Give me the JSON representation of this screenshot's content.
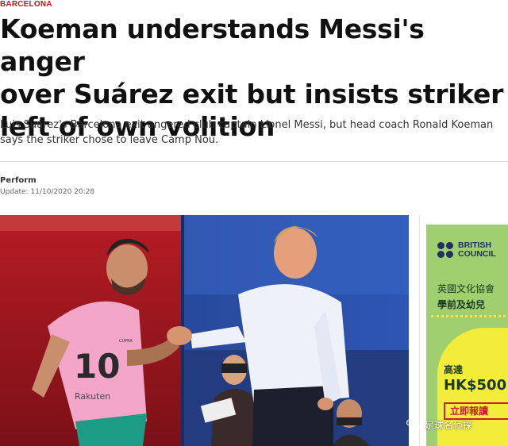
{
  "article": {
    "category": "BARCELONA",
    "headline_lines": [
      "Koeman understands Messi's anger",
      "over Suárez exit but insists striker",
      "left of own volition"
    ],
    "dek_lines": [
      "Luis Suárez's Barcelona exit angered club captain Lionel Messi, but head coach Ronald Koeman",
      "says the striker chose to leave Camp Nou."
    ],
    "author": "Perform",
    "updated": "Update: 11/10/2020 20:28"
  },
  "photo": {
    "shirt_number": "10",
    "shirt_sponsor": "Rakuten",
    "kit_brand": "CUPRA"
  },
  "ad": {
    "brand_lines": [
      "BRITISH",
      "COUNCIL"
    ],
    "line1": "英國文化協會",
    "line2": "學前及幼兒",
    "line3": "高達",
    "price": "HK$500",
    "cta": "立即報讀"
  },
  "watermark": {
    "text": "足球名侦探",
    "icon": "wechat-icon"
  },
  "colors": {
    "category_red": "#c0181c",
    "ad_green": "#9fcf6e",
    "ad_yellow": "#f2ec3a",
    "ad_navy": "#232f5e"
  }
}
